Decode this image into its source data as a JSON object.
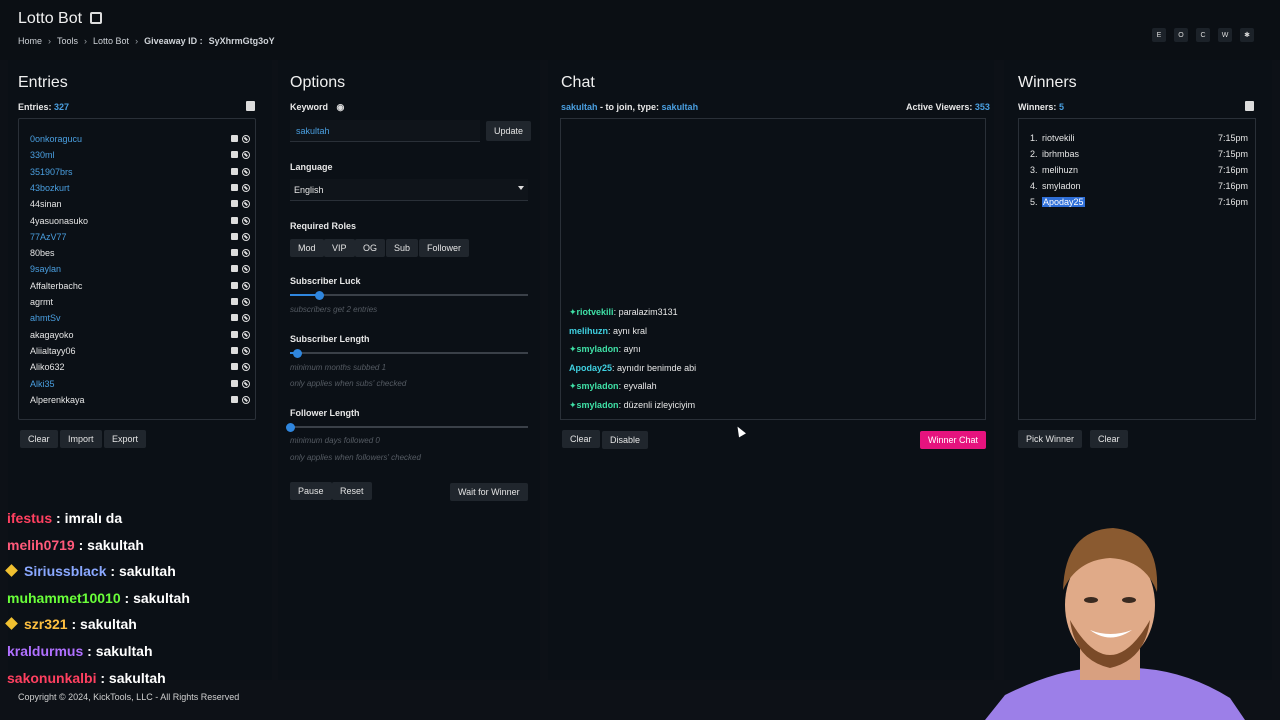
{
  "header": {
    "app_title": "Lotto Bot",
    "breadcrumb": [
      "Home",
      "Tools",
      "Lotto Bot"
    ],
    "giveaway_label": "Giveaway ID :",
    "giveaway_id": "SyXhrmGtg3oY",
    "top_icons": [
      "E",
      "O",
      "C",
      "W",
      "✱"
    ]
  },
  "entries": {
    "title": "Entries",
    "count_label": "Entries:",
    "count": "327",
    "items": [
      {
        "name": "0onkoragucu",
        "sub": true
      },
      {
        "name": "330ml",
        "sub": true
      },
      {
        "name": "351907brs",
        "sub": true
      },
      {
        "name": "43bozkurt",
        "sub": true
      },
      {
        "name": "44sinan",
        "sub": false
      },
      {
        "name": "4yasuonasuko",
        "sub": false
      },
      {
        "name": "77AzV77",
        "sub": true
      },
      {
        "name": "80bes",
        "sub": false
      },
      {
        "name": "9saylan",
        "sub": true
      },
      {
        "name": "Affalterbachc",
        "sub": false
      },
      {
        "name": "agrmt",
        "sub": false
      },
      {
        "name": "ahmtSv",
        "sub": true
      },
      {
        "name": "akagayoko",
        "sub": false
      },
      {
        "name": "Aliialtayy06",
        "sub": false
      },
      {
        "name": "Aliko632",
        "sub": false
      },
      {
        "name": "Alki35",
        "sub": true
      },
      {
        "name": "Alperenkkaya",
        "sub": false
      }
    ],
    "clear": "Clear",
    "import": "Import",
    "export": "Export"
  },
  "options": {
    "title": "Options",
    "keyword_label": "Keyword",
    "keyword_value": "sakultah",
    "update": "Update",
    "language_label": "Language",
    "language_value": "English",
    "roles_label": "Required Roles",
    "roles": [
      "Mod",
      "VIP",
      "OG",
      "Sub",
      "Follower"
    ],
    "sub_luck_label": "Subscriber Luck",
    "sub_luck_hint": "subscribers get 2 entries",
    "sub_luck_level": 0.12,
    "sub_length_label": "Subscriber Length",
    "sub_length_hint": "minimum months subbed 1",
    "sub_length_hint2": "only applies when subs' checked",
    "sub_length_level": 0.03,
    "follower_length_label": "Follower Length",
    "follower_length_hint": "minimum days followed 0",
    "follower_length_hint2": "only applies when followers' checked",
    "follower_length_level": 0.0,
    "pause": "Pause",
    "reset": "Reset",
    "wait": "Wait for Winner"
  },
  "chat": {
    "title": "Chat",
    "channel": "sakultah",
    "join_text": "- to join, type:",
    "join_keyword": "sakultah",
    "viewers_label": "Active Viewers:",
    "viewers": "353",
    "messages": [
      {
        "user": "riotvekili",
        "text": "paralazim3131",
        "sub": true
      },
      {
        "user": "melihuzn",
        "text": "aynı kral",
        "sub": false
      },
      {
        "user": "smyladon",
        "text": "aynı",
        "sub": true
      },
      {
        "user": "Apoday25",
        "text": "aynıdır benimde abi",
        "sub": false
      },
      {
        "user": "smyladon",
        "text": "eyvallah",
        "sub": true
      },
      {
        "user": "smyladon",
        "text": "düzenli izleyiciyim",
        "sub": true
      }
    ],
    "clear": "Clear",
    "disable": "Disable",
    "winner_chat": "Winner Chat"
  },
  "winners": {
    "title": "Winners",
    "count_label": "Winners:",
    "count": "5",
    "items": [
      {
        "n": "1.",
        "name": "riotvekili",
        "time": "7:15pm"
      },
      {
        "n": "2.",
        "name": "ibrhmbas",
        "time": "7:15pm"
      },
      {
        "n": "3.",
        "name": "melihuzn",
        "time": "7:16pm"
      },
      {
        "n": "4.",
        "name": "smyladon",
        "time": "7:16pm"
      },
      {
        "n": "5.",
        "name": "Apoday25",
        "time": "7:16pm"
      }
    ],
    "pick": "Pick Winner",
    "clear": "Clear"
  },
  "overlay_chat": [
    {
      "user": "ifestus",
      "text": " : imralı da",
      "color": "#ff4060",
      "badge": false
    },
    {
      "user": "melih0719",
      "text": " : sakultah",
      "color": "#ff5a7a",
      "badge": false
    },
    {
      "user": "Siriussblack",
      "text": " : sakultah",
      "color": "#8aa8ff",
      "badge": true
    },
    {
      "user": "muhammet10010",
      "text": " : sakultah",
      "color": "#6aff3a",
      "badge": false
    },
    {
      "user": "szr321",
      "text": " : sakultah",
      "color": "#ffc040",
      "badge": true
    },
    {
      "user": "kraldurmus",
      "text": " : sakultah",
      "color": "#b070ff",
      "badge": false
    },
    {
      "user": "sakonunkalbi",
      "text": " : sakultah",
      "color": "#ff4060",
      "badge": false
    }
  ],
  "footer": "Copyright © 2024, KickTools, LLC - All Rights Reserved",
  "colors": {
    "accent": "#2f86de",
    "winner_chat": "#e6137e",
    "panel": "#0b1016"
  }
}
